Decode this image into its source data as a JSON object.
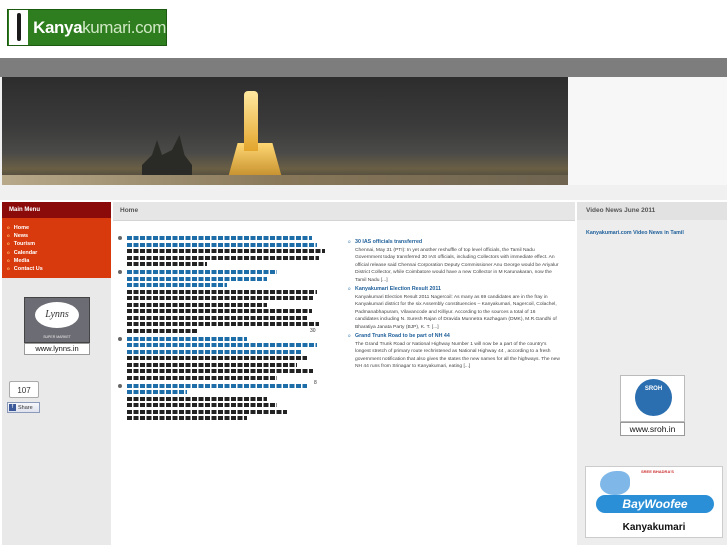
{
  "site": {
    "logo_main": "Kanya",
    "logo_accent": "kumari.com"
  },
  "left_menu": {
    "title": "Main Menu",
    "items": [
      {
        "label": "Home"
      },
      {
        "label": "News"
      },
      {
        "label": "Tourism"
      },
      {
        "label": "Calendar"
      },
      {
        "label": "Media"
      },
      {
        "label": "Contact Us"
      }
    ]
  },
  "ads": {
    "lynns_logo": "Lynns",
    "lynns_sub": "SUPER MARKET",
    "lynns_url": "www.lynns.in",
    "sroh_logo": "SROH",
    "sroh_url": "www.sroh.in",
    "bay_top": "SREE BHADRA'S",
    "bay_logo": "BayWoofee",
    "bay_city": "Kanyakumari"
  },
  "social": {
    "like_count": "107",
    "share_label": "Share",
    "fb_icon": "f"
  },
  "main": {
    "title": "Home",
    "tamil_numbers": [
      "30",
      "8"
    ],
    "news": [
      {
        "title": "30 IAS officials transferred",
        "body": "Chennai, May 31 (PTI): In yet another reshuffle of top level officials, the Tamil Nadu Government today transferred 30 IAS officials, including Collectors with immediate effect. An official release said Chennai Corporation Deputy Commissioner Anu George would be Ariyalur District Collector, while Coimbatore would have a new Collector in M Karunakaran, now the Tamil Nadu [...]"
      },
      {
        "title": "Kanyakumari Election Result 2011",
        "body": "Kanyakumari Election Result 2011 Nagercoil: As many as 69 candidates are in the fray in Kanyakumari district for the six Assembly constituencies – Kanyakumari, Nagercoil, Colachel, Padmanabhapuram, Vilavancode and Killiyur. According to the sources a total of 16 candidates including N. Suresh Rajan of Dravida Munnetra Kazhagam (DMK), M.R.Gandhi of Bharatiya Janata Party (BJP), K. T. [...]"
      },
      {
        "title": "Grand Trunk Road to be part of NH 44",
        "body": "The Grand Trunk Road or National Highway Number 1 will now be a part of the country's longest stretch of primary route rechristened as National Highway 44 , according to a fresh government notification that also gives the states the new names for all the highways. The new NH 44 runs from Srinagar to Kanyakumari, eating [...]"
      }
    ]
  },
  "right": {
    "title": "Video News June 2011",
    "link": "Kanyakumari.com Video News in Tamil"
  },
  "colors": {
    "menu_title_bg": "#8b0b0b",
    "menu_bg": "#d83a0e",
    "link_blue": "#1d5e99",
    "logo_green": "#2e7d1e"
  }
}
